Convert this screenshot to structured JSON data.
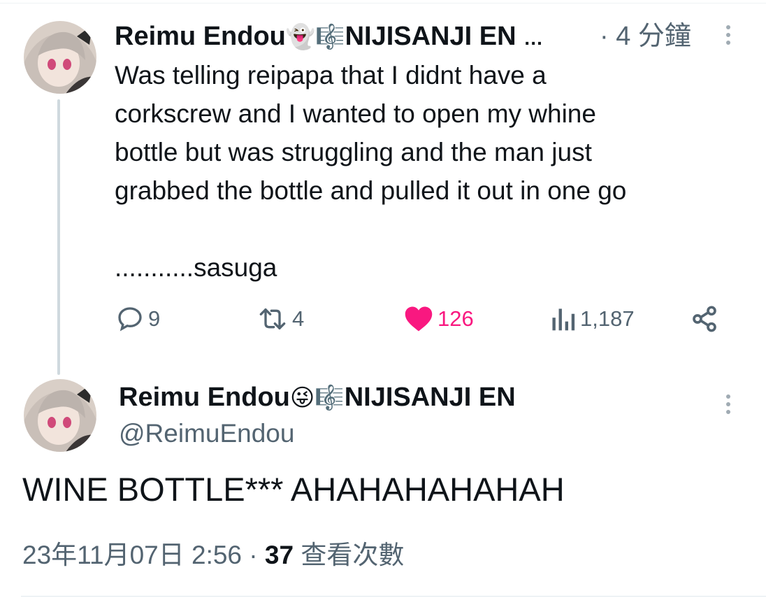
{
  "tweet": {
    "author_name": "Reimu Endou",
    "badges": [
      "👻",
      "🎼"
    ],
    "org": "NIJISANJI EN",
    "ellipsis": "…",
    "time": "· 4 分鐘",
    "text": "Was telling reipapa that I didnt have a\ncorkscrew and I wanted to open my whine\nbottle but was struggling and the man just\ngrabbed the bottle and pulled it out in one go\n\n...........sasuga",
    "actions": {
      "replies": "9",
      "retweets": "4",
      "likes": "126",
      "views": "1,187"
    },
    "icons": [
      "comment-icon",
      "retweet-icon",
      "heart-icon",
      "views-icon",
      "share-icon",
      "more-icon"
    ],
    "colors": {
      "like": "#f91880",
      "muted": "#536471",
      "thread_line": "#cfd9de"
    }
  },
  "reply": {
    "author_name": "Reimu Endou",
    "badges": [
      "😜",
      "🎼"
    ],
    "org": "NIJISANJI EN",
    "handle": "@ReimuEndou",
    "text": "WINE BOTTLE*** AHAHAHAHAHAH",
    "date": "23年11月07日 2:56",
    "separator": " · ",
    "views_count": "37",
    "views_label": " 查看次數"
  }
}
